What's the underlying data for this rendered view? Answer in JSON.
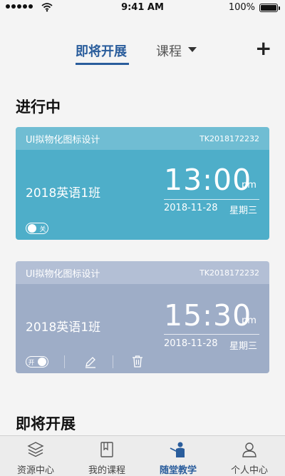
{
  "status_bar": {
    "time": "9:41 AM",
    "battery": "100%"
  },
  "tabs": {
    "upcoming": "即将开展",
    "course": "课程"
  },
  "add_label": "+",
  "sections": {
    "ongoing": "进行中",
    "upcoming": "即将开展"
  },
  "cards": [
    {
      "course_name": "UI拟物化图标设计",
      "code": "TK2018172232",
      "class_name": "2018英语1班",
      "time": "13:00",
      "meridiem": "pm",
      "date": "2018-11-28",
      "weekday": "星期三",
      "toggle_label": "关",
      "toggle_on": false,
      "color": "#4eaec9"
    },
    {
      "course_name": "UI拟物化图标设计",
      "code": "TK2018172232",
      "class_name": "2018英语1班",
      "time": "15:30",
      "meridiem": "pm",
      "date": "2018-11-28",
      "weekday": "星期三",
      "toggle_label": "开",
      "toggle_on": true,
      "color": "#9eadc7"
    }
  ],
  "nav": {
    "items": [
      {
        "label": "资源中心",
        "icon": "layers-icon"
      },
      {
        "label": "我的课程",
        "icon": "book-icon"
      },
      {
        "label": "随堂教学",
        "icon": "teacher-icon"
      },
      {
        "label": "个人中心",
        "icon": "person-icon"
      }
    ],
    "active_index": 2,
    "active_color": "#2a5d9c"
  }
}
